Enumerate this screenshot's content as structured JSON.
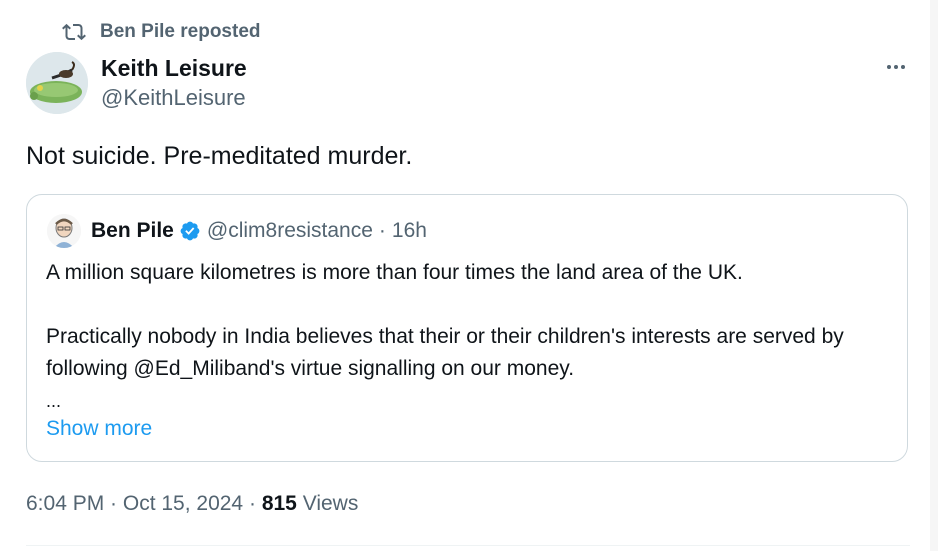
{
  "repost": {
    "label": "Ben Pile reposted",
    "icon": "repost-icon"
  },
  "tweet": {
    "author_name": "Keith Leisure",
    "author_handle": "@KeithLeisure",
    "text": "Not suicide. Pre-meditated murder.",
    "more_icon": "more-icon",
    "timestamp": "6:04 PM · Oct 15, 2024",
    "separator": "·",
    "views_count": "815",
    "views_label": "Views"
  },
  "quote": {
    "author_name": "Ben Pile",
    "verified_icon": "verified-badge-icon",
    "author_handle": "@clim8resistance",
    "separator": "·",
    "time": "16h",
    "paragraph1": "A million square kilometres is more than four times the land area of the UK.",
    "paragraph2": "Practically nobody in India believes that their or their children's interests are served by following @Ed_Miliband's virtue signalling on our money.",
    "ellipsis": "...",
    "show_more": "Show more"
  },
  "colors": {
    "text_primary": "#0f1419",
    "text_secondary": "#536471",
    "accent": "#1d9bf0",
    "border": "#cfd9de"
  }
}
